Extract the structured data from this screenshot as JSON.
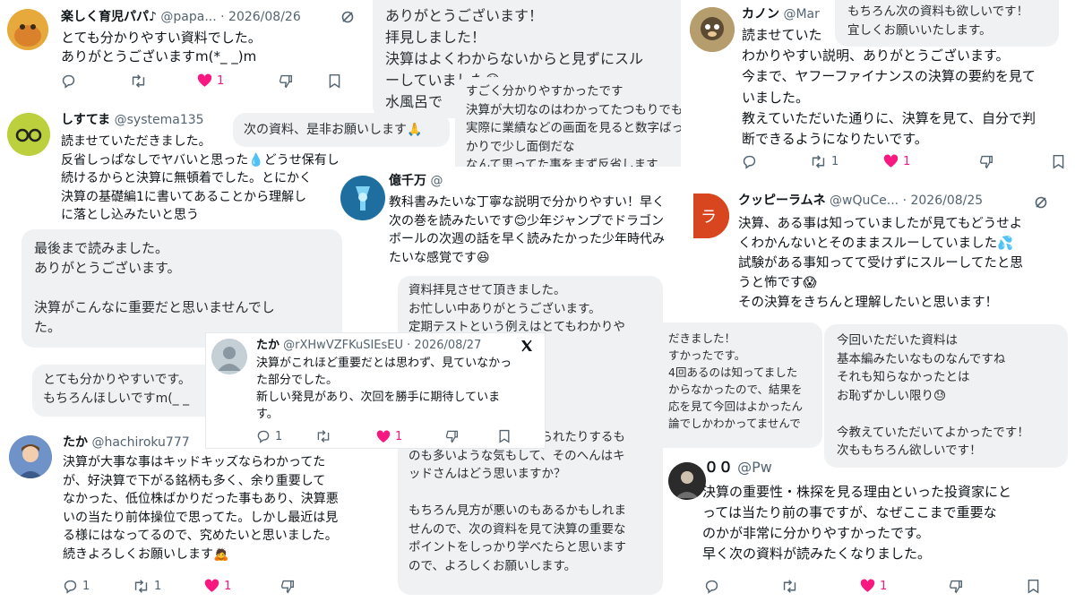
{
  "colors": {
    "like": "#f91880",
    "icon_gray": "#536471",
    "bubble_bg": "#eff1f3",
    "text": "#0f1419"
  },
  "icons": [
    "reply-icon",
    "retweet-icon",
    "heart-icon",
    "dislike-icon",
    "bookmark-icon",
    "share-icon",
    "grok-icon",
    "x-logo-icon"
  ],
  "tweets": {
    "papa": {
      "name": "楽しく育児パパ♪",
      "handle": "@papa...",
      "date": "· 2026/08/26",
      "text": "とても分かりやすい資料でした。\nありがとうございますm(*_ _)m",
      "likes": "1"
    },
    "systema": {
      "name": "しすてま",
      "handle": "@systema135",
      "text": "読ませていただきました。\n反省しっぱなしでヤバいと思った💧どうせ保有し\n続けるからと決算に無頓着でした。とにかく\n決算の基礎編1に書いてあることから理解し\nに落とし込みたいと思う"
    },
    "taka_hachi": {
      "name": "たか",
      "handle": "@hachiroku777",
      "text": "決算が大事な事はキッドキッズならわかってた\nが、好決算で下がる銘柄も多く、余り重要して\nなかった、低位株ばかりだった事もあり、決算悪\nいの当たり前体操位で思ってた。しかし最近は見\nる様にはなってるので、究めたいと思いました。\n続きよろしくお願いします🙇",
      "replies": "1",
      "retweets": "1",
      "likes": "1"
    },
    "okusenman": {
      "name": "億千万",
      "handle": "@",
      "text": "教科書みたいな丁寧な説明で分かりやすい！早く\n次の巻を読みたいです😊少年ジャンプでドラゴン\nボールの次週の話を早く読みたかった少年時代み\nたいな感覚です😆"
    },
    "kanon": {
      "name": "カノン",
      "handle": "@Mar",
      "text": "読ませていた\nわかりやすい説明、ありがとうございます。\n今まで、ヤフーファイナンスの決算の要約を見て\nいました。\n教えていただいた通りに、決算を見て、自分で判\n断できるようになりたいです。",
      "retweets": "1",
      "likes": "1"
    },
    "kuppy": {
      "name": "クッピーラムネ",
      "handle": "@wQuCe...",
      "date": "· 2026/08/25",
      "text": "決算、ある事は知っていましたが見てもどうせよ\nくわかんないとそのままスルーしていました💦\n試験がある事知ってて受けずにスルーしてたと思\nうと怖です😱\nその決算をきちんと理解したいと思います！"
    },
    "oo": {
      "name": "００",
      "handle": "@Pw",
      "text": "決算の重要性・株探を見る理由といった投資家にと\nっては当たり前の事ですが、なぜここまで重要な\nのかが非常に分かりやすかったです。\n早く次の資料が読みたくなりました。",
      "likes": "1"
    },
    "taka_x": {
      "name": "たか",
      "handle": "@rXHwVZFKuSIEsEU",
      "date": "· 2026/08/27",
      "text": "決算がこれほど重要だとは思わず、見ていなかっ\nた部分でした。\n新しい発見があり、次回を勝手に期待していま\nす。",
      "replies": "1",
      "likes": "1"
    }
  },
  "bubbles": {
    "arigato": "ありがとうございます！\n拝見しました！\n決算はよくわからないからと見ずにスル\nーしていました😅\n水風呂で",
    "wakariyasui": "すごく分かりやすかったです\n決算が大切なのはわかってたつもりでも\n実際に業績などの画面を見ると数字ばっ\nかりで少し面倒だな\nなんて思ってた事をまず反省します",
    "tsugi": "次の資料、是非お願いします🙏",
    "mochiron": "もちろん次の資料も欲しいです！\n宜しくお願いいたします。",
    "saigo": "最後まで読みました。\nありがとうございます。\n\n決算がこんなに重要だと思いませんでし\nた。",
    "totemo": "とても分かりやすいです。\nもちろんほしいですm(_ _",
    "shiryo": "資料拝見させて頂きました。\nお忙しい中ありがとうございます。\n定期テストという例えはとてもわかりや\nす\nがとても伝わって\n\nよく持ち越すか手\n\n最近は決算が良くても売られたりするも\nのも多いような気もして、そのへんはキ\nッドさんはどう思いますか？\n\nもちろん見方が悪いのもあるかもしれま\nせんので、次の資料を見て決算の重要な\nポイントをしっかり学べたらと思います\nので、よろしくお願いします。",
    "dakimashita": "だきました！\nすかったです。\n4回あるのは知ってました\nからなかったので、結果を\n応を見て今回はよかったん\n論でしかわかってませんで",
    "konkai": "今回いただいた資料は\n基本編みたいなものなんですね\nそれも知らなかったとは\nお恥ずかしい限り😓\n\n今教えていただいてよかったです！\n次ももちろん欲しいです！"
  }
}
